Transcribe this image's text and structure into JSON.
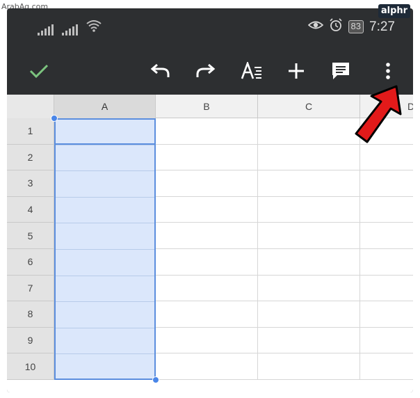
{
  "watermark": "ArabAq.com",
  "brand": "alphr",
  "status_bar": {
    "battery": "83",
    "time": "7:27",
    "icons": [
      "signal-icon",
      "signal-icon",
      "wifi-icon",
      "eye-icon",
      "alarm-icon",
      "battery-icon"
    ]
  },
  "toolbar": {
    "icons": [
      "check-icon",
      "undo-icon",
      "redo-icon",
      "text-format-icon",
      "add-icon",
      "comment-icon",
      "more-vert-icon"
    ]
  },
  "sheet": {
    "columns": [
      "A",
      "B",
      "C",
      "D"
    ],
    "rows": [
      "1",
      "2",
      "3",
      "4",
      "5",
      "6",
      "7",
      "8",
      "9",
      "10"
    ],
    "selected_column": "A"
  },
  "colors": {
    "toolbar_bg": "#2d2f31",
    "accent_green": "#7cc47f",
    "selection_fill": "#dbe7fb",
    "selection_border": "#5b8ede",
    "arrow": "#e21a1a"
  }
}
